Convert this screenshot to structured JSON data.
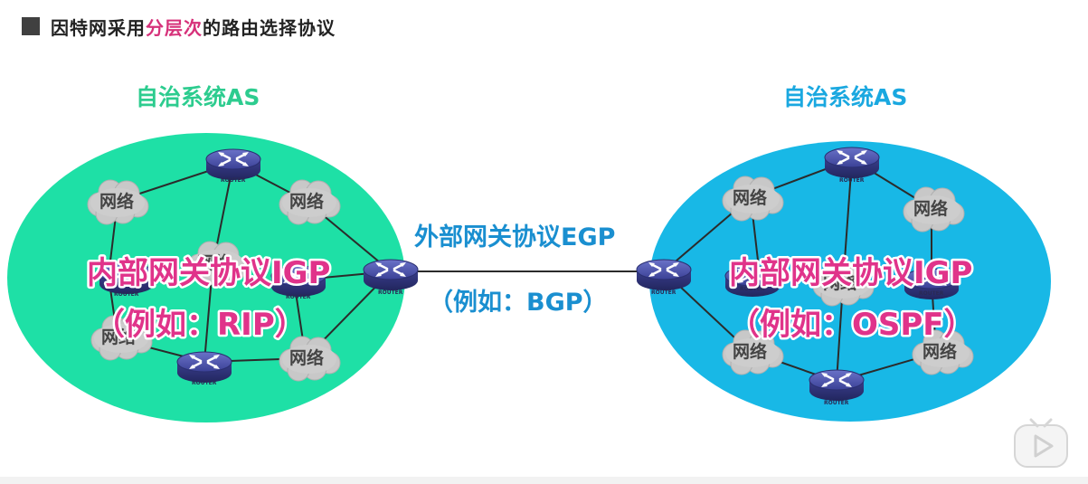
{
  "title": {
    "prefix": "因特网采用",
    "highlight": "分层次",
    "suffix": "的路由选择协议"
  },
  "left_as": {
    "label": "自治系统AS",
    "label_color": "#2dcc8f",
    "fill_color": "#1ee0a6",
    "igp": "内部网关协议IGP",
    "igp_example": "（例如：RIP）",
    "clouds": [
      "网络",
      "网络",
      "网络",
      "网络",
      "网络"
    ]
  },
  "right_as": {
    "label": "自治系统AS",
    "label_color": "#1aa8e0",
    "fill_color": "#18b8e6",
    "igp": "内部网关协议IGP",
    "igp_example": "（例如：OSPF）",
    "clouds": [
      "网络",
      "网络",
      "网络",
      "网络",
      "网络"
    ]
  },
  "egp": {
    "label": "外部网关协议EGP",
    "example": "（例如：BGP）"
  },
  "router_text": "ROUTER",
  "icons": [
    "router-icon",
    "cloud-icon",
    "play-icon"
  ]
}
